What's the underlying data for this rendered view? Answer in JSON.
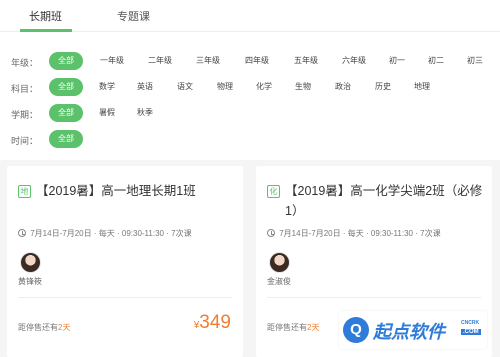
{
  "tabs": [
    {
      "label": "长期班",
      "active": true
    },
    {
      "label": "专题课",
      "active": false
    }
  ],
  "filters": {
    "grade": {
      "label": "年级：",
      "options": [
        "全部",
        "一年级",
        "二年级",
        "三年级",
        "四年级",
        "五年级",
        "六年级",
        "初一",
        "初二",
        "初三"
      ]
    },
    "subject": {
      "label": "科目：",
      "options": [
        "全部",
        "数学",
        "英语",
        "语文",
        "物理",
        "化学",
        "生物",
        "政治",
        "历史",
        "地理"
      ]
    },
    "term": {
      "label": "学期：",
      "options": [
        "全部",
        "暑假",
        "秋季"
      ]
    },
    "time": {
      "label": "时间：",
      "options": [
        "全部"
      ]
    }
  },
  "courses": [
    {
      "subject_badge": "地",
      "title": "【2019暑】高一地理长期1班",
      "dates": "7月14日-7月20日",
      "frequency": "每天",
      "time": "09:30-11:30",
      "sessions": "7次课",
      "teacher": "黄锋筱",
      "stop_prefix": "距停售还有",
      "stop_days": "2天",
      "currency": "¥",
      "price": "349"
    },
    {
      "subject_badge": "化",
      "title": "【2019暑】高一化学尖端2班（必修1）",
      "dates": "7月14日-7月20日",
      "frequency": "每天",
      "time": "09:30-11:30",
      "sessions": "7次课",
      "teacher": "金淑俊",
      "stop_prefix": "距停售还有",
      "stop_days": "2天"
    }
  ],
  "watermark": {
    "logo": "Q",
    "text": "起点软件",
    "en": "CNCRK",
    "domain": ".COM"
  },
  "colors": {
    "accent": "#5bc16b",
    "price": "#ef7d32",
    "watermark": "#2f7bd9"
  }
}
